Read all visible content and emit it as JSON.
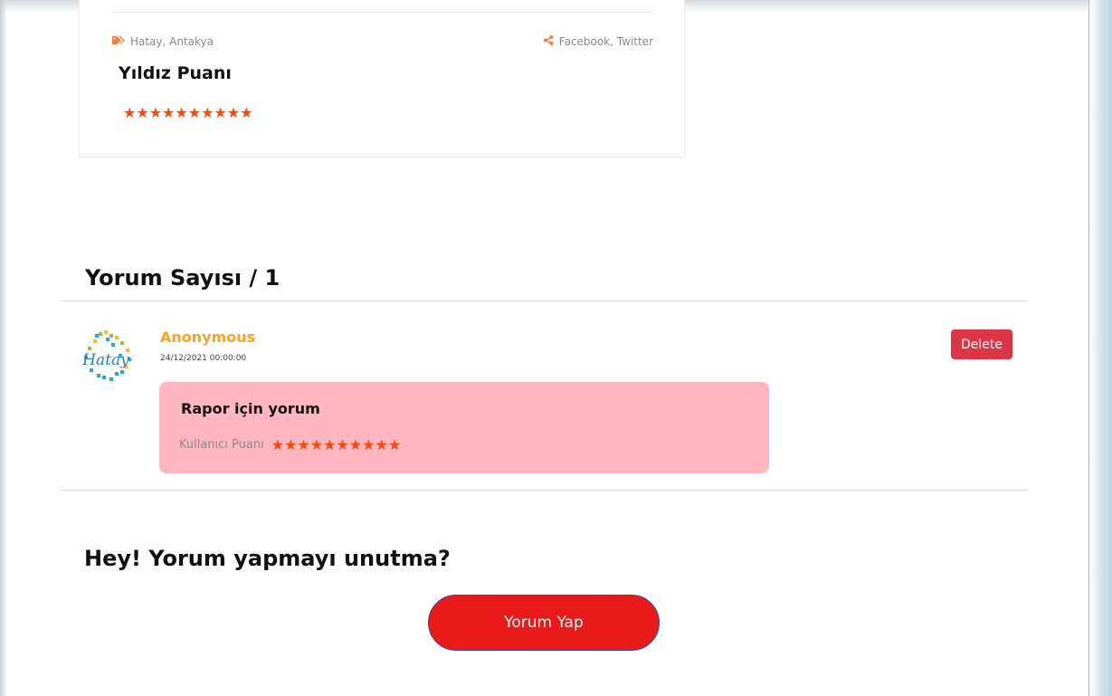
{
  "post": {
    "tags_text": "Hatay, Antakya",
    "share_text": "Facebook, Twitter",
    "star_title": "Yıldız Puanı",
    "stars": "★★★★★★★★★★"
  },
  "comments": {
    "heading": "Yorum Sayısı  / 1",
    "items": [
      {
        "author": "Anonymous",
        "date": "24/12/2021 00:00:00",
        "title": "Rapor için yorum",
        "rating_label": "Kullanıcı Puanı",
        "stars": "★★★★★★★★★★",
        "delete_label": "Delete",
        "avatar_logo_text": "Hatay"
      }
    ]
  },
  "cta": {
    "heading": "Hey! Yorum yapmayı unutma?",
    "button_label": "Yorum Yap"
  },
  "colors": {
    "star": "#f44a0b",
    "author": "#f5a623",
    "comment_bg": "#ffb6c1",
    "delete_bg": "#dc3545",
    "cta_bg": "#e81a1a"
  }
}
